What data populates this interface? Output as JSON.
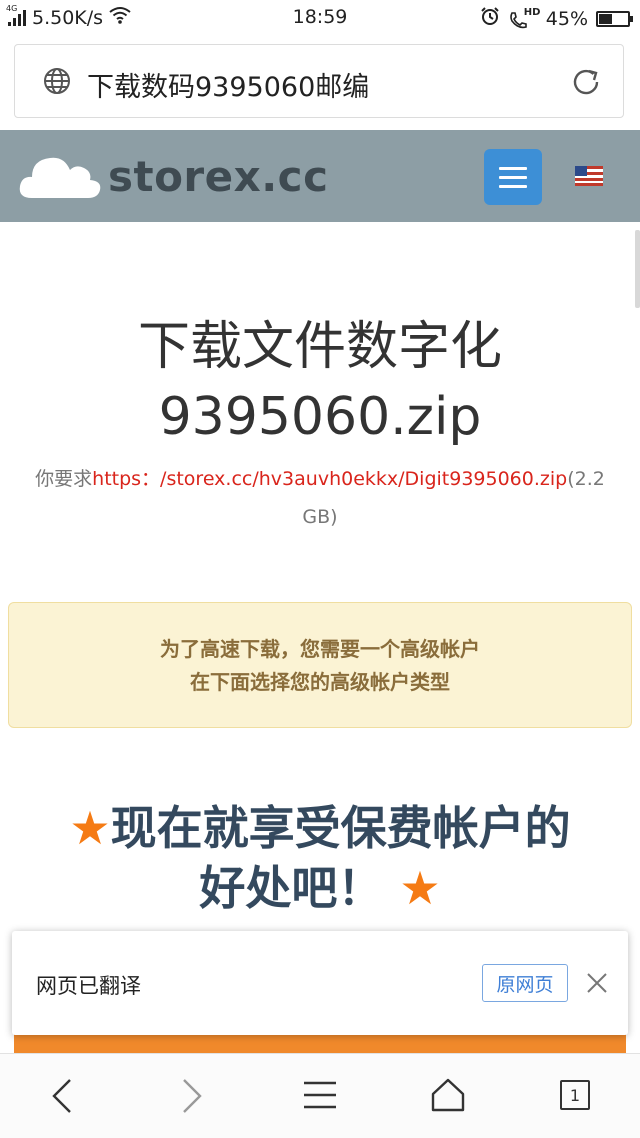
{
  "status_bar": {
    "network": "4G",
    "speed": "5.50K/s",
    "time": "18:59",
    "hd": "HD",
    "battery_text": "45%",
    "battery_level": 0.45
  },
  "address_bar": {
    "text": "下载数码9395060邮编"
  },
  "site": {
    "logo_text": "storex.cc"
  },
  "main": {
    "title_line1": "下载文件数字化",
    "title_line2": "9395060.zip",
    "request_prefix": "你要求",
    "request_link": "https：/storex.cc/hv3auvh0ekkx/Digit9395060.zip",
    "request_size": "(2.2 GB)",
    "alert_line1": "为了高速下载，您需要一个高级帐户",
    "alert_line2": "在下面选择您的高级帐户类型",
    "benefit_star": "★",
    "benefit_line1": "现在就享受保费帐户的",
    "benefit_line2": "好处吧！"
  },
  "translate_toast": {
    "message": "网页已翻译",
    "original_button": "原网页"
  },
  "bottom_nav": {
    "tab_count": "1"
  },
  "colors": {
    "header_bg": "#8d9ea5",
    "menu_button": "#3d8fd6",
    "link_red": "#d9251c",
    "alert_bg": "#fbf3d4",
    "alert_text": "#8a6d3b",
    "benefit_text": "#34495e",
    "star_orange": "#f57b14"
  }
}
